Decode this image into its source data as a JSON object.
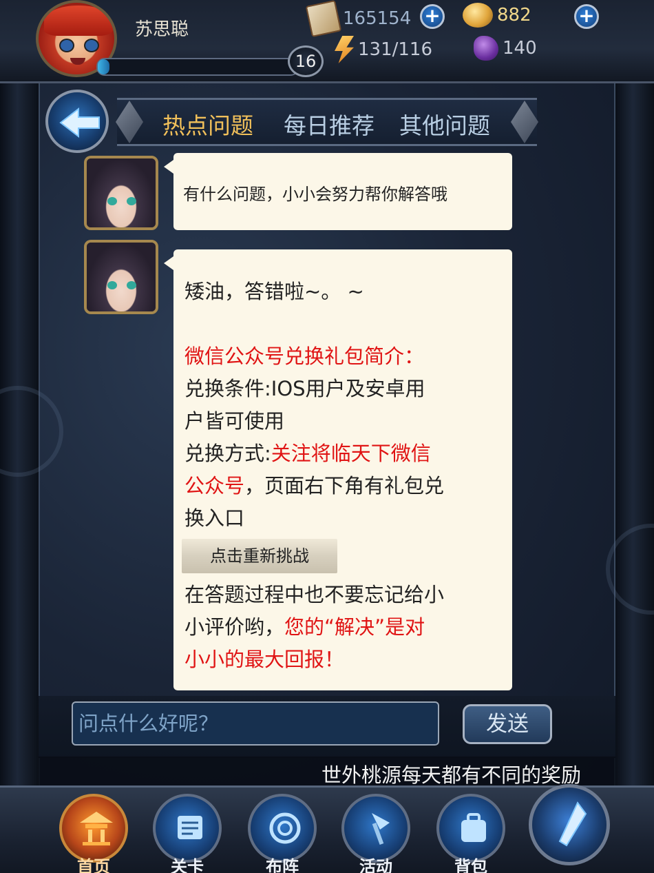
{
  "player": {
    "name": "苏思聪",
    "level": "16",
    "exp_fraction": 0.06
  },
  "resources": {
    "cards": "165154",
    "gold": "882",
    "energy": "131/116",
    "gems": "140"
  },
  "tabs": [
    {
      "label": "热点问题",
      "active": true
    },
    {
      "label": "每日推荐",
      "active": false
    },
    {
      "label": "其他问题",
      "active": false
    }
  ],
  "chat": {
    "greeting": "有什么问题，小小会努力帮你解答哦",
    "answer": {
      "line1": "矮油，答错啦~。 ~",
      "heading": "微信公众号兑换礼包简介：",
      "cond_a": "兑换条件:IOS用户及安卓用",
      "cond_b": "户皆可使用",
      "method_label": "兑换方式:",
      "method_red_a": "关注将临天下微信",
      "method_red_b": "公众号",
      "method_rest_a": "，页面右下角有礼包兑",
      "method_rest_b": "换入口",
      "retry_label": "点击重新挑战",
      "rate_a": "在答题过程中也不要忘记给小",
      "rate_b_black": "小评价哟，",
      "rate_b_red": "您的“解决”是对",
      "rate_c_red": "小小的最大回报！"
    }
  },
  "input": {
    "placeholder": "问点什么好呢？",
    "send_label": "发送"
  },
  "marquee": "世外桃源每天都有不同的奖励",
  "nav": {
    "home": "首页",
    "stage": "关卡",
    "formation": "布阵",
    "event": "活动",
    "bag": "背包"
  },
  "colors": {
    "active_tab": "#f1c05a",
    "inactive_tab": "#b9cfe4",
    "highlight_red": "#e01414",
    "bubble_bg": "#fcf7e8"
  }
}
